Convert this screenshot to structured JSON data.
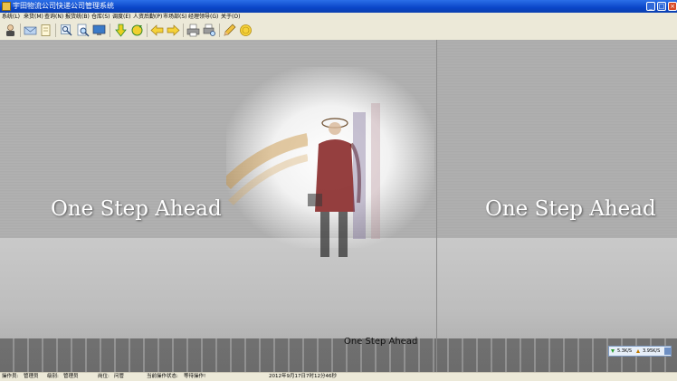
{
  "window": {
    "title": "宇田物流公司快递公司管理系统",
    "minimize": "_",
    "maximize": "□",
    "close": "×"
  },
  "menu": [
    {
      "label": "系统(L)"
    },
    {
      "label": "来货(M)"
    },
    {
      "label": "查询(N)"
    },
    {
      "label": "报货统(B)"
    },
    {
      "label": "仓库(S)"
    },
    {
      "label": "调度(E)"
    },
    {
      "label": "人资后勤(P)"
    },
    {
      "label": "市场部(S)"
    },
    {
      "label": "经理领导(G)"
    },
    {
      "label": "关于(O)"
    }
  ],
  "toolbar": {
    "icons": [
      "user-icon",
      "mail-icon",
      "notebook-icon",
      "magnify-icon",
      "magnify-doc-icon",
      "monitor-icon",
      "arrow-down-icon",
      "refresh-icon",
      "back-arrow-icon",
      "forward-arrow-icon",
      "printer-icon",
      "print-preview-icon",
      "pencil-icon",
      "coin-icon"
    ]
  },
  "main": {
    "tagline": "One Step Ahead",
    "tagline_small": "One Step Ahead"
  },
  "net_widget": {
    "download": "5.3K/S",
    "upload": "3.95K/S"
  },
  "status": {
    "operator_label": "操作员:",
    "operator_value": "管理员",
    "level_label": "级别:",
    "level_value": "管理员",
    "position_label": "岗位:",
    "position_value": "问管",
    "op_status_label": "当前操作状态:",
    "op_status_value": "等待操作!",
    "datetime": "2012年9月17日7时12分46秒"
  }
}
